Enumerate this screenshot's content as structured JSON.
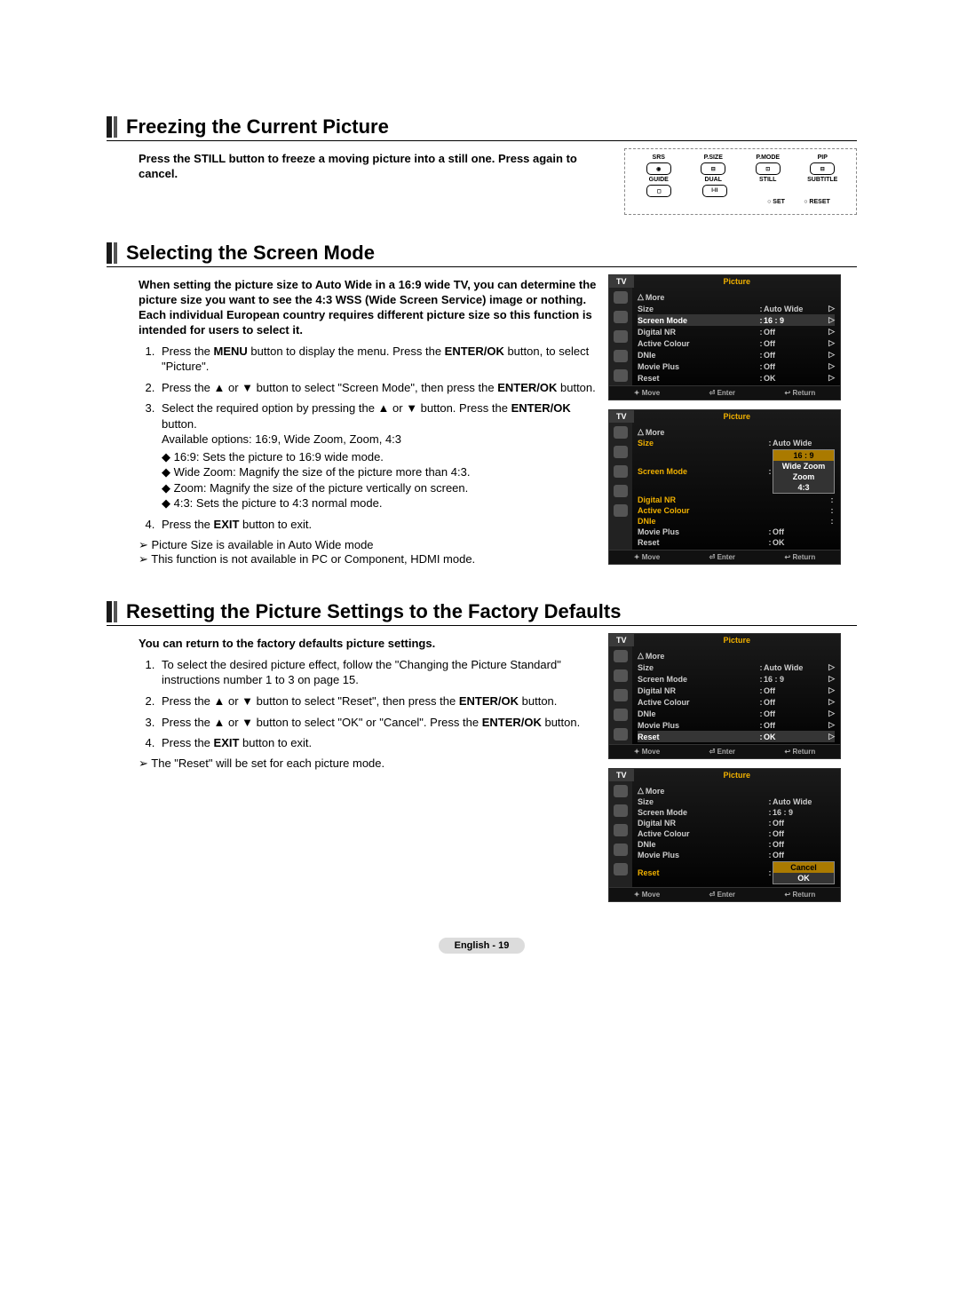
{
  "sections": {
    "freeze": {
      "title": "Freezing the Current Picture",
      "intro": "Press the STILL button to freeze a moving picture into a still one. Press again to cancel."
    },
    "screen_mode": {
      "title": "Selecting the Screen Mode",
      "intro": "When setting the picture size to Auto Wide in a 16:9 wide TV, you can determine the picture size you want to see the 4:3 WSS (Wide Screen Service) image or nothing. Each individual European country requires different picture size so this function is intended for users to select it.",
      "steps": [
        "Press the MENU button to display the menu. Press the ENTER/OK button, to select \"Picture\".",
        "Press the ▲ or ▼ button to select \"Screen Mode\", then press the ENTER/OK button.",
        "Select the required option by pressing the ▲ or ▼ button. Press the ENTER/OK button.",
        "Press the EXIT button to exit."
      ],
      "available_label": "Available options: 16:9, Wide Zoom, Zoom, 4:3",
      "options": [
        "16:9: Sets the picture to 16:9 wide mode.",
        "Wide Zoom: Magnify the size of the picture more than 4:3.",
        "Zoom: Magnify the size of the picture vertically on screen.",
        "4:3: Sets the picture to 4:3 normal mode."
      ],
      "notes": [
        "Picture Size is available in Auto Wide mode",
        "This function is not available in PC or Component, HDMI mode."
      ]
    },
    "reset": {
      "title": "Resetting the Picture Settings to the Factory Defaults",
      "intro": "You can return to the factory defaults picture settings.",
      "steps": [
        "To select the desired picture effect, follow the \"Changing the Picture Standard\" instructions number 1 to 3 on page 15.",
        "Press the ▲ or ▼ button to select \"Reset\", then press the ENTER/OK button.",
        "Press the ▲ or ▼ button to select \"OK\" or \"Cancel\". Press the ENTER/OK button.",
        "Press the EXIT button to exit."
      ],
      "notes": [
        "The \"Reset\" will be set for each picture mode."
      ]
    }
  },
  "remote": {
    "row1": [
      "SRS",
      "P.SIZE",
      "P.MODE",
      "PIP"
    ],
    "row2": [
      "GUIDE",
      "DUAL",
      "STILL",
      "SUBTITLE"
    ],
    "row3_left": "SET",
    "row3_right": "RESET"
  },
  "osd_common": {
    "tv_label": "TV",
    "title": "Picture",
    "more": "More",
    "footer_move": "Move",
    "footer_enter": "Enter",
    "footer_return": "Return"
  },
  "menu_items": {
    "size": "Size",
    "screen_mode": "Screen Mode",
    "digital_nr": "Digital NR",
    "active_colour": "Active Colour",
    "dnie": "DNIe",
    "movie_plus": "Movie Plus",
    "reset": "Reset"
  },
  "menu_values": {
    "auto_wide": "Auto Wide",
    "ratio_169": "16 : 9",
    "off": "Off",
    "ok": "OK",
    "wide_zoom": "Wide Zoom",
    "zoom": "Zoom",
    "ratio_43": "4:3",
    "cancel": "Cancel"
  },
  "footer": "English - 19"
}
